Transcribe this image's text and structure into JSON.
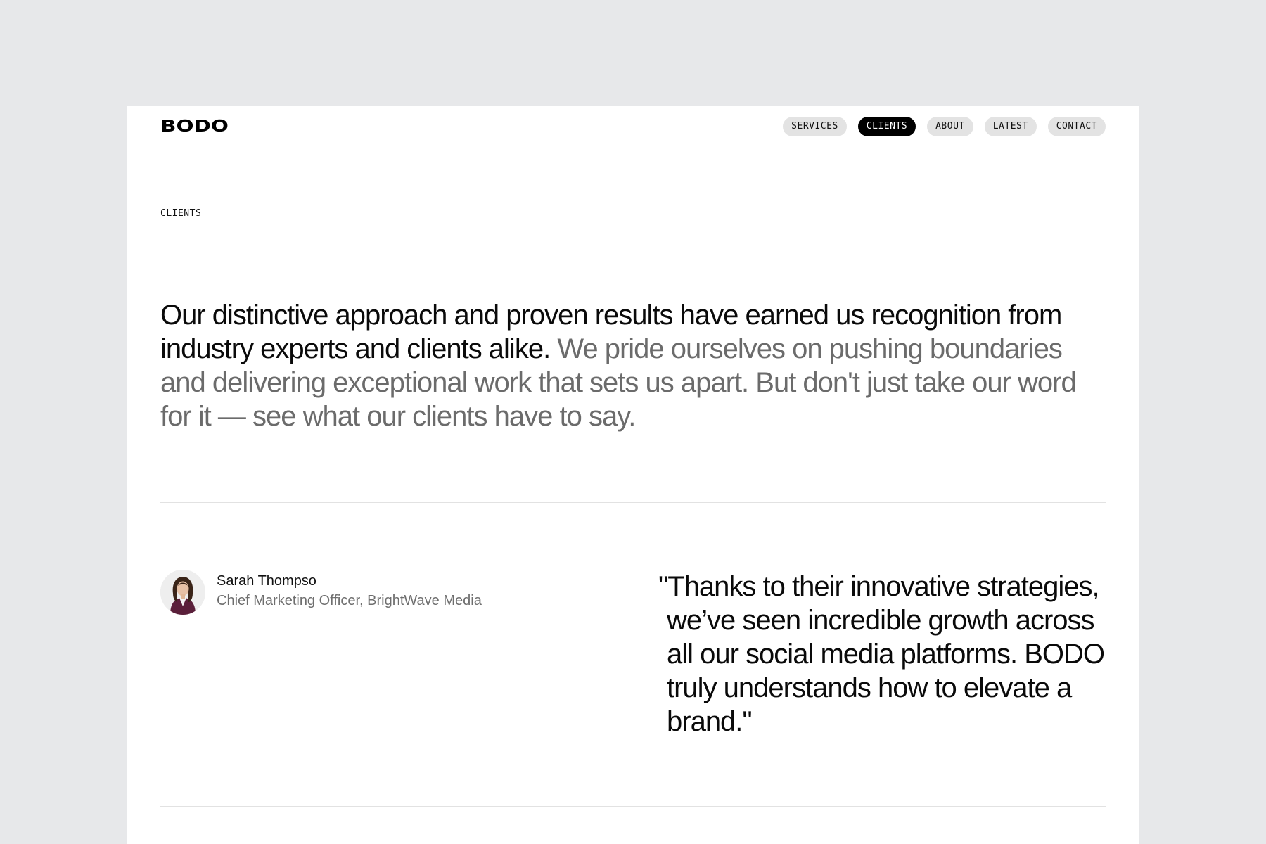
{
  "header": {
    "logo": "BODO",
    "nav": [
      {
        "label": "SERVICES",
        "active": false
      },
      {
        "label": "CLIENTS",
        "active": true
      },
      {
        "label": "ABOUT",
        "active": false
      },
      {
        "label": "LATEST",
        "active": false
      },
      {
        "label": "CONTACT",
        "active": false
      }
    ]
  },
  "section": {
    "label": "CLIENTS"
  },
  "intro": {
    "dark_text": "Our distinctive approach and proven results have earned us recognition from industry experts and clients alike.",
    "muted_text": "We pride ourselves on pushing boundaries and delivering exceptional work that sets us apart. But don't just take our word for it — see what our clients have to say."
  },
  "testimonial": {
    "name": "Sarah Thompso",
    "role": "Chief Marketing Officer, BrightWave Media",
    "quote": "\"Thanks to their innovative strategies, we’ve seen incredible growth across all our social media platforms. BODO truly understands how to elevate a brand.\""
  },
  "colors": {
    "background": "#e7e8ea",
    "page": "#ffffff",
    "nav_pill": "#e3e3e3",
    "nav_active": "#000000",
    "muted_text": "#6b6b6b"
  }
}
